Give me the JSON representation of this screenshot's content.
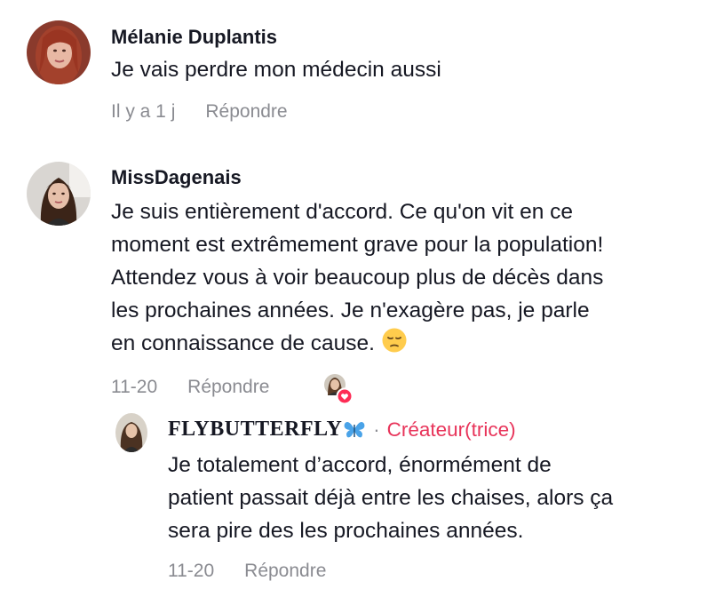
{
  "comments": [
    {
      "username": "Mélanie Duplantis",
      "text": "Je vais perdre mon médecin aussi",
      "time": "Il y a 1 j",
      "reply_label": "Répondre"
    },
    {
      "username": "MissDagenais",
      "text_lines": [
        "Je suis entièrement d'accord. Ce qu'on vit en ce",
        "moment est extrêmement grave pour la population!",
        "Attendez vous à voir beaucoup plus de décès dans",
        "les prochaines années. Je n'exagère pas, je parle",
        "en connaissance de cause."
      ],
      "emoji": "pensive-face-icon",
      "time": "11-20",
      "reply_label": "Répondre",
      "liked_by_creator": true
    }
  ],
  "reply": {
    "username": "FLYBUTTERFLY",
    "username_emoji": "butterfly-icon",
    "separator": "·",
    "badge": "Créateur(trice)",
    "text_lines": [
      "Je totalement d’accord, énormément de",
      "patient passait déjà entre les chaises, alors ça",
      "sera pire des les prochaines années."
    ],
    "time": "11-20",
    "reply_label": "Répondre"
  },
  "colors": {
    "text": "#161823",
    "meta": "#8a8b91",
    "creator_badge": "#e8345a",
    "heart": "#fe2c55"
  }
}
